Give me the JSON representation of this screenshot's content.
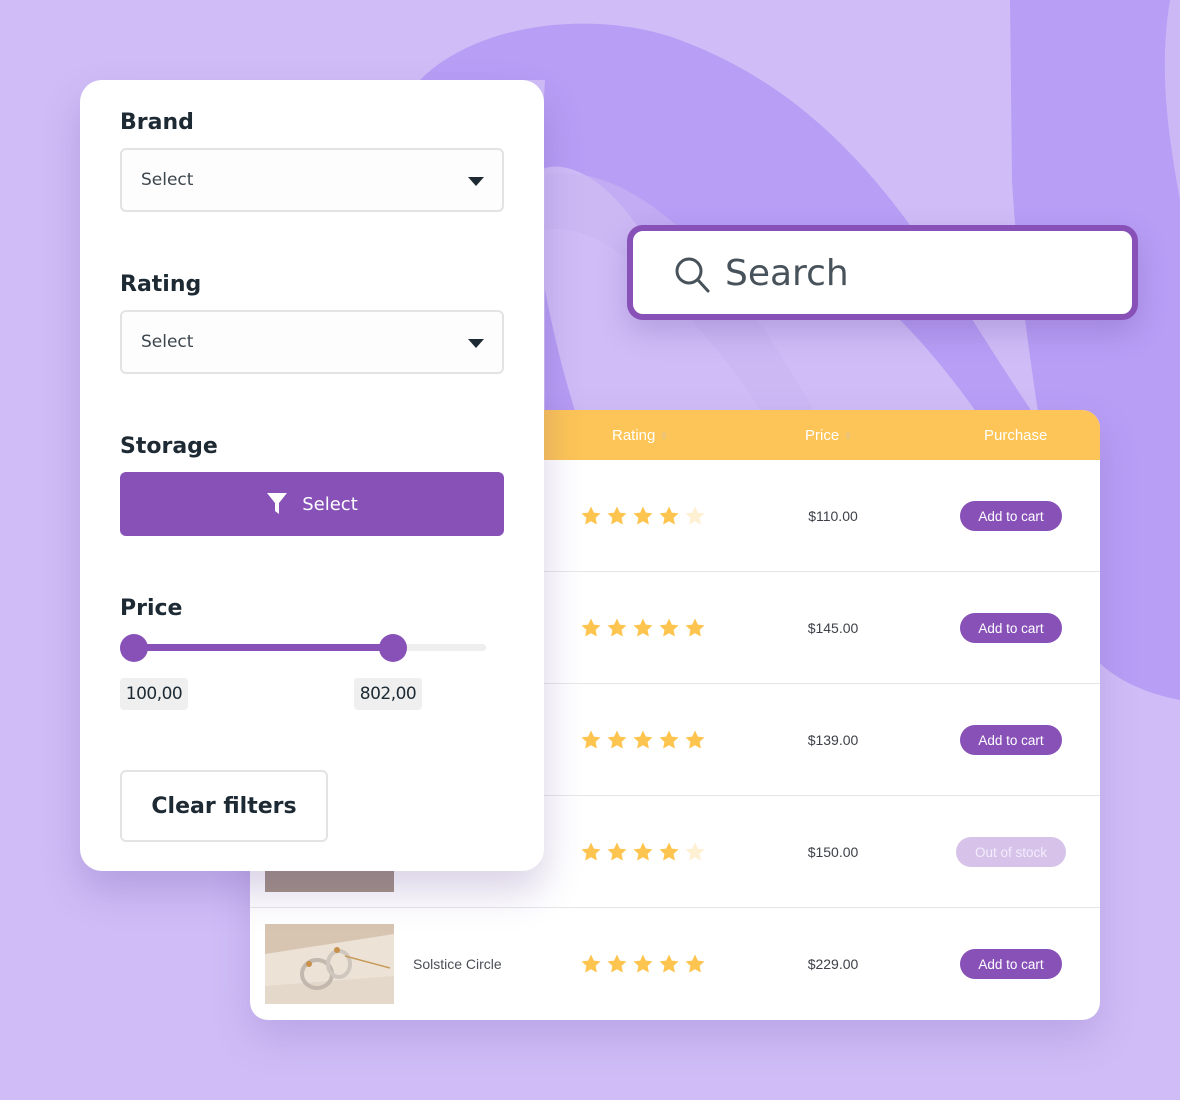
{
  "theme": {
    "accent": "#8751b8",
    "header_bg": "#fdc557",
    "star_on": "#fdc54f",
    "star_off": "#fdf0d3",
    "background": "#d0bdf7"
  },
  "filters": {
    "brand": {
      "label": "Brand",
      "value": "Select"
    },
    "rating": {
      "label": "Rating",
      "value": "Select"
    },
    "storage": {
      "label": "Storage",
      "button_label": "Select",
      "icon": "funnel-icon"
    },
    "price": {
      "label": "Price",
      "min_value": "100,00",
      "max_value": "802,00",
      "low_handle_fraction": 0.0,
      "high_handle_fraction": 0.74
    },
    "clear_label": "Clear filters"
  },
  "search": {
    "placeholder": "Search",
    "icon": "search-icon"
  },
  "table": {
    "columns": [
      {
        "label": "Rating",
        "sortable": true
      },
      {
        "label": "Price",
        "sortable": true
      },
      {
        "label": "Purchase",
        "sortable": false
      }
    ],
    "rows": [
      {
        "name": "",
        "rating": 4,
        "price": "$110.00",
        "action": "Add to cart",
        "in_stock": true
      },
      {
        "name": "",
        "rating": 5,
        "price": "$145.00",
        "action": "Add to cart",
        "in_stock": true
      },
      {
        "name": "",
        "rating": 5,
        "price": "$139.00",
        "action": "Add to cart",
        "in_stock": true
      },
      {
        "name": "",
        "rating": 4,
        "price": "$150.00",
        "action": "Out of stock",
        "in_stock": false
      },
      {
        "name": "Solstice Circle",
        "rating": 5,
        "price": "$229.00",
        "action": "Add to cart",
        "in_stock": true
      }
    ]
  }
}
